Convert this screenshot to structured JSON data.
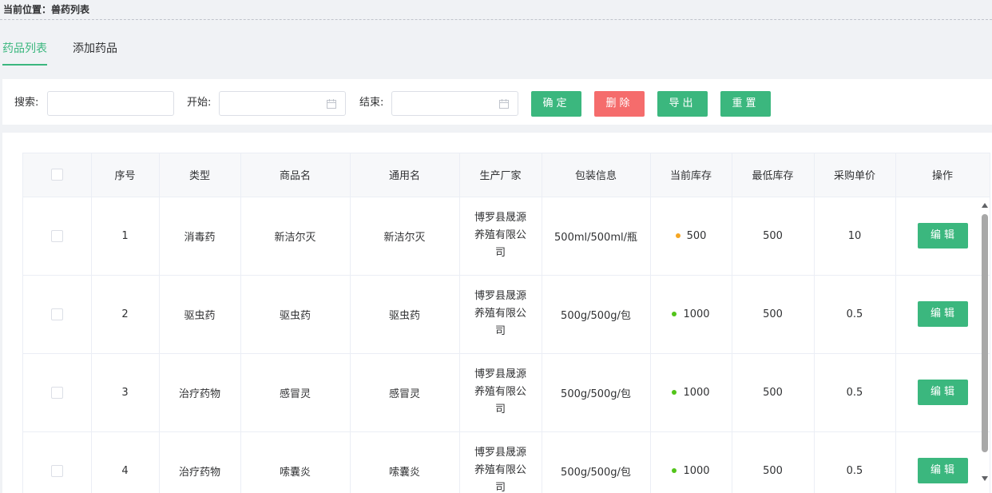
{
  "breadcrumb": {
    "text": "当前位置：兽药列表"
  },
  "tabs": [
    {
      "label": "药品列表",
      "active": true
    },
    {
      "label": "添加药品",
      "active": false
    }
  ],
  "toolbar": {
    "search_label": "搜索:",
    "search_value": "",
    "start_label": "开始:",
    "end_label": "结束:",
    "confirm_label": "确定",
    "delete_label": "删除",
    "export_label": "导出",
    "reset_label": "重置"
  },
  "colors": {
    "accent": "#3bb77e",
    "danger": "#f56c6c",
    "stock_warning": "#f5a623",
    "stock_ok": "#52c41a"
  },
  "table": {
    "columns": [
      "序号",
      "类型",
      "商品名",
      "通用名",
      "生产厂家",
      "包装信息",
      "当前库存",
      "最低库存",
      "采购单价",
      "操作"
    ],
    "edit_label": "编辑",
    "rows": [
      {
        "no": "1",
        "type": "消毒药",
        "name": "新洁尔灭",
        "generic": "新洁尔灭",
        "maker": "博罗县晟源养殖有限公司",
        "pack": "500ml/500ml/瓶",
        "stock": "500",
        "stock_status": "warning",
        "min": "500",
        "price": "10"
      },
      {
        "no": "2",
        "type": "驱虫药",
        "name": "驱虫药",
        "generic": "驱虫药",
        "maker": "博罗县晟源养殖有限公司",
        "pack": "500g/500g/包",
        "stock": "1000",
        "stock_status": "ok",
        "min": "500",
        "price": "0.5"
      },
      {
        "no": "3",
        "type": "治疗药物",
        "name": "感冒灵",
        "generic": "感冒灵",
        "maker": "博罗县晟源养殖有限公司",
        "pack": "500g/500g/包",
        "stock": "1000",
        "stock_status": "ok",
        "min": "500",
        "price": "0.5"
      },
      {
        "no": "4",
        "type": "治疗药物",
        "name": "嗦囊炎",
        "generic": "嗦囊炎",
        "maker": "博罗县晟源养殖有限公司",
        "pack": "500g/500g/包",
        "stock": "1000",
        "stock_status": "ok",
        "min": "500",
        "price": "0.5"
      }
    ]
  }
}
